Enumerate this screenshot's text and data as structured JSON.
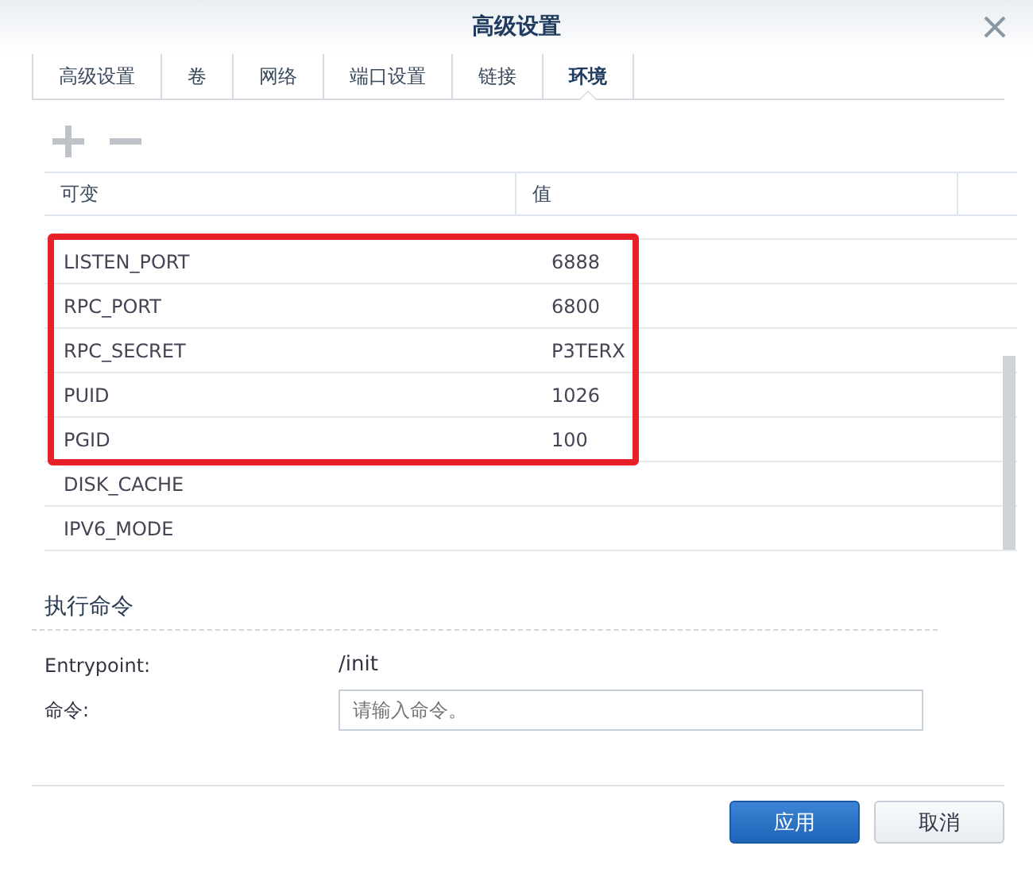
{
  "window": {
    "title": "高级设置"
  },
  "tabs": [
    {
      "label": "高级设置",
      "selected": false
    },
    {
      "label": "卷",
      "selected": false
    },
    {
      "label": "网络",
      "selected": false
    },
    {
      "label": "端口设置",
      "selected": false
    },
    {
      "label": "链接",
      "selected": false
    },
    {
      "label": "环境",
      "selected": true
    }
  ],
  "toolbar": {
    "add_disabled": true,
    "remove_disabled": true
  },
  "table": {
    "columns": [
      "可变",
      "值"
    ],
    "rows": [
      {
        "variable": "LISTEN_PORT",
        "value": "6888",
        "highlighted": true
      },
      {
        "variable": "RPC_PORT",
        "value": "6800",
        "highlighted": true
      },
      {
        "variable": "RPC_SECRET",
        "value": "P3TERX",
        "highlighted": true
      },
      {
        "variable": "PUID",
        "value": "1026",
        "highlighted": true
      },
      {
        "variable": "PGID",
        "value": "100",
        "highlighted": true
      },
      {
        "variable": "DISK_CACHE",
        "value": "",
        "highlighted": false
      },
      {
        "variable": "IPV6_MODE",
        "value": "",
        "highlighted": false
      }
    ]
  },
  "command_section": {
    "title": "执行命令",
    "entrypoint_label": "Entrypoint:",
    "entrypoint_value": "/init",
    "command_label": "命令:",
    "command_placeholder": "请输入命令。"
  },
  "buttons": [
    {
      "label": "应用",
      "kind": "primary"
    },
    {
      "label": "取消",
      "kind": "secondary"
    }
  ]
}
